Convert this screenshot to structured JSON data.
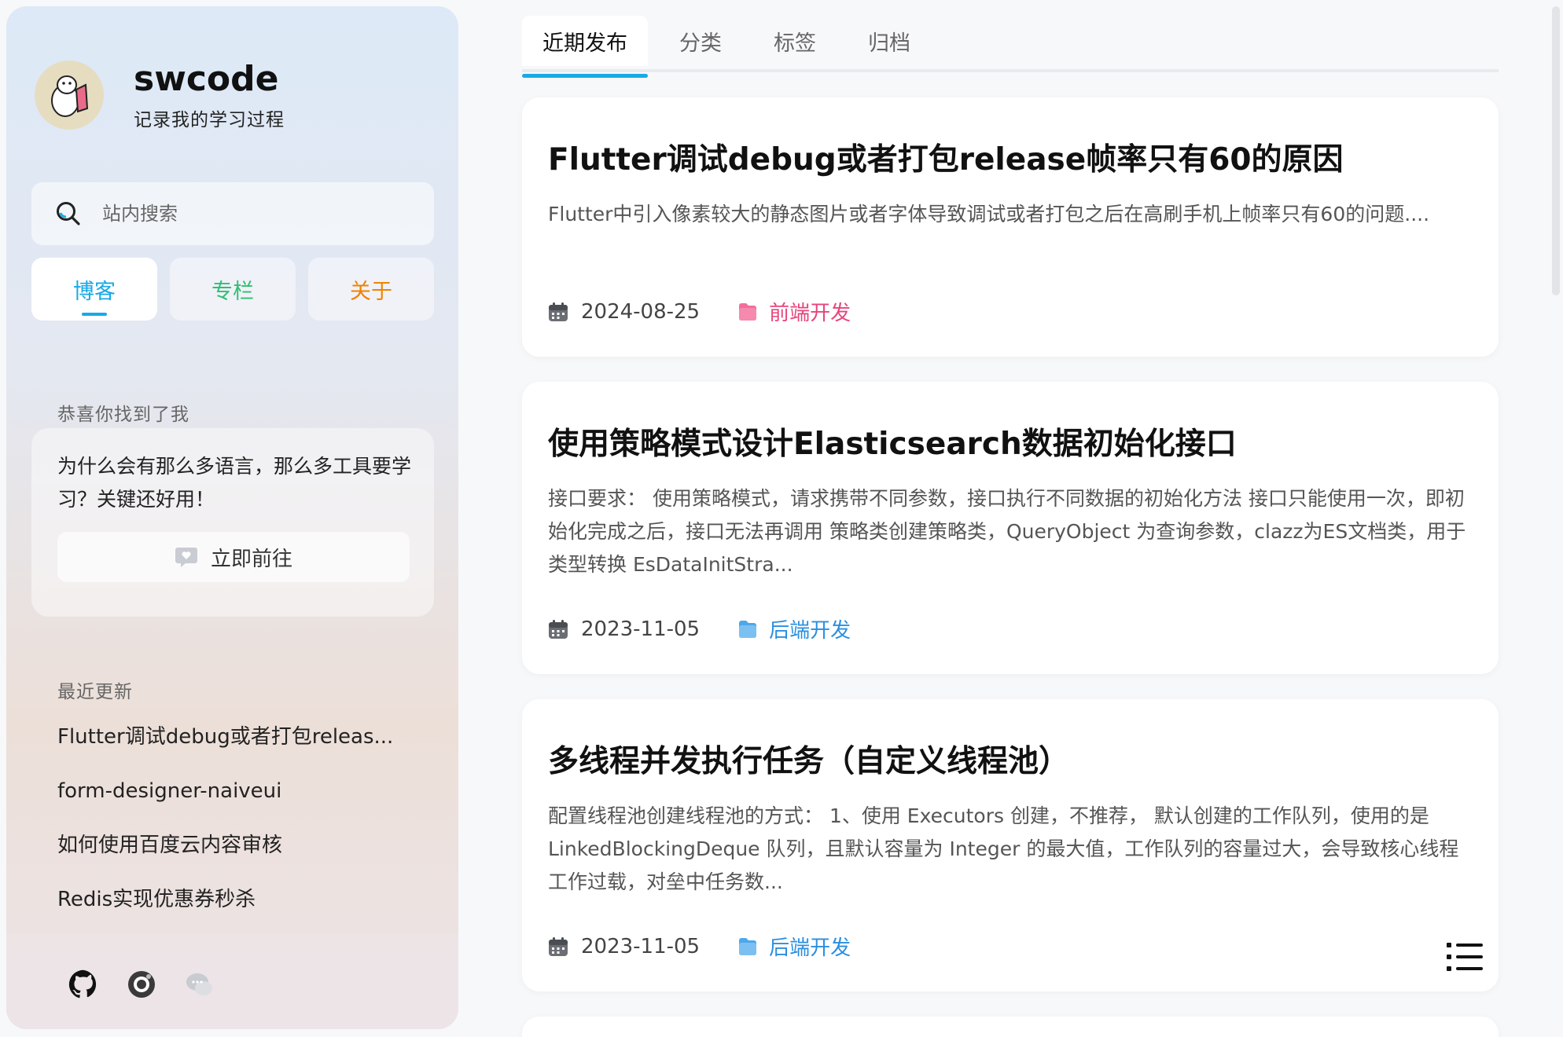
{
  "sidebar": {
    "site_name": "swcode",
    "tagline": "记录我的学习过程",
    "search": {
      "placeholder": "站内搜索"
    },
    "nav": [
      {
        "label": "博客",
        "color": "#18a9e6",
        "active": true
      },
      {
        "label": "专栏",
        "color": "#2fbf71",
        "active": false
      },
      {
        "label": "关于",
        "color": "#f08300",
        "active": false
      }
    ],
    "promo": {
      "heading": "恭喜你找到了我",
      "text": "为什么会有那么多语言，那么多工具要学习？关键还好用！",
      "button_label": "立即前往"
    },
    "recent": {
      "heading": "最近更新",
      "items": [
        "Flutter调试debug或者打包releas...",
        "form-designer-naiveui",
        "如何使用百度云内容审核",
        "Redis实现优惠券秒杀"
      ]
    },
    "socials": [
      "github-icon",
      "camera-icon",
      "chat-icon"
    ]
  },
  "tabs": [
    {
      "label": "近期发布",
      "active": true
    },
    {
      "label": "分类",
      "active": false
    },
    {
      "label": "标签",
      "active": false
    },
    {
      "label": "归档",
      "active": false
    }
  ],
  "posts": [
    {
      "title": "Flutter调试debug或者打包release帧率只有60的原因",
      "summary": "Flutter中引入像素较大的静态图片或者字体导致调试或者打包之后在高刷手机上帧率只有60的问题....",
      "date": "2024-08-25",
      "category": "前端开发",
      "category_color": "#e8457b"
    },
    {
      "title": "使用策略模式设计Elasticsearch数据初始化接口",
      "summary": "接口要求： 使用策略模式，请求携带不同参数，接口执行不同数据的初始化方法 接口只能使用一次，即初始化完成之后，接口无法再调用 策略类创建策略类，QueryObject 为查询参数，clazz为ES文档类，用于类型转换 EsDataInitStra...",
      "date": "2023-11-05",
      "category": "后端开发",
      "category_color": "#2b8fe0"
    },
    {
      "title": "多线程并发执行任务（自定义线程池）",
      "summary": "配置线程池创建线程池的方式： 1、使用 Executors 创建，不推荐， 默认创建的工作队列，使用的是 LinkedBlockingDeque 队列，且默认容量为 Integer 的最大值，工作队列的容量过大，会导致核心线程工作过载，对垒中任务数...",
      "date": "2023-11-05",
      "category": "后端开发",
      "category_color": "#2b8fe0"
    }
  ]
}
